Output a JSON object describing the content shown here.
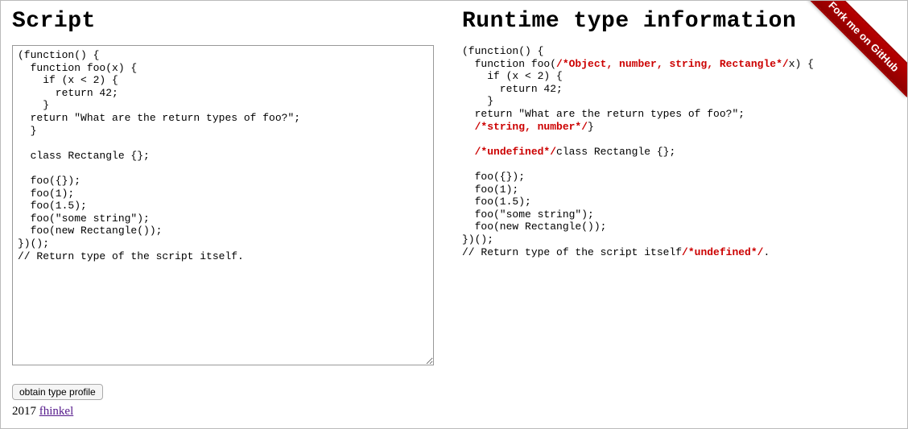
{
  "left": {
    "heading": "Script",
    "script": "(function() {\n  function foo(x) {\n    if (x < 2) {\n      return 42;\n    }\n  return \"What are the return types of foo?\";\n  }\n\n  class Rectangle {};\n\n  foo({});\n  foo(1);\n  foo(1.5);\n  foo(\"some string\");\n  foo(new Rectangle());\n})();\n// Return type of the script itself."
  },
  "right": {
    "heading": "Runtime type information",
    "segments": [
      {
        "t": "(function() {\n  function foo("
      },
      {
        "t": "/*Object, number, string, Rectangle*/",
        "tp": true
      },
      {
        "t": "x) {\n    if (x < 2) {\n      return 42;\n    }\n  return \"What are the return types of foo?\";\n  "
      },
      {
        "t": "/*string, number*/",
        "tp": true
      },
      {
        "t": "}\n\n  "
      },
      {
        "t": "/*undefined*/",
        "tp": true
      },
      {
        "t": "class Rectangle {};\n\n  foo({});\n  foo(1);\n  foo(1.5);\n  foo(\"some string\");\n  foo(new Rectangle());\n})();\n// Return type of the script itself"
      },
      {
        "t": "/*undefined*/",
        "tp": true
      },
      {
        "t": "."
      }
    ]
  },
  "controls": {
    "obtain_label": "obtain type profile"
  },
  "footer": {
    "year": "2017",
    "author": "fhinkel"
  },
  "ribbon": {
    "label": "Fork me on GitHub"
  }
}
